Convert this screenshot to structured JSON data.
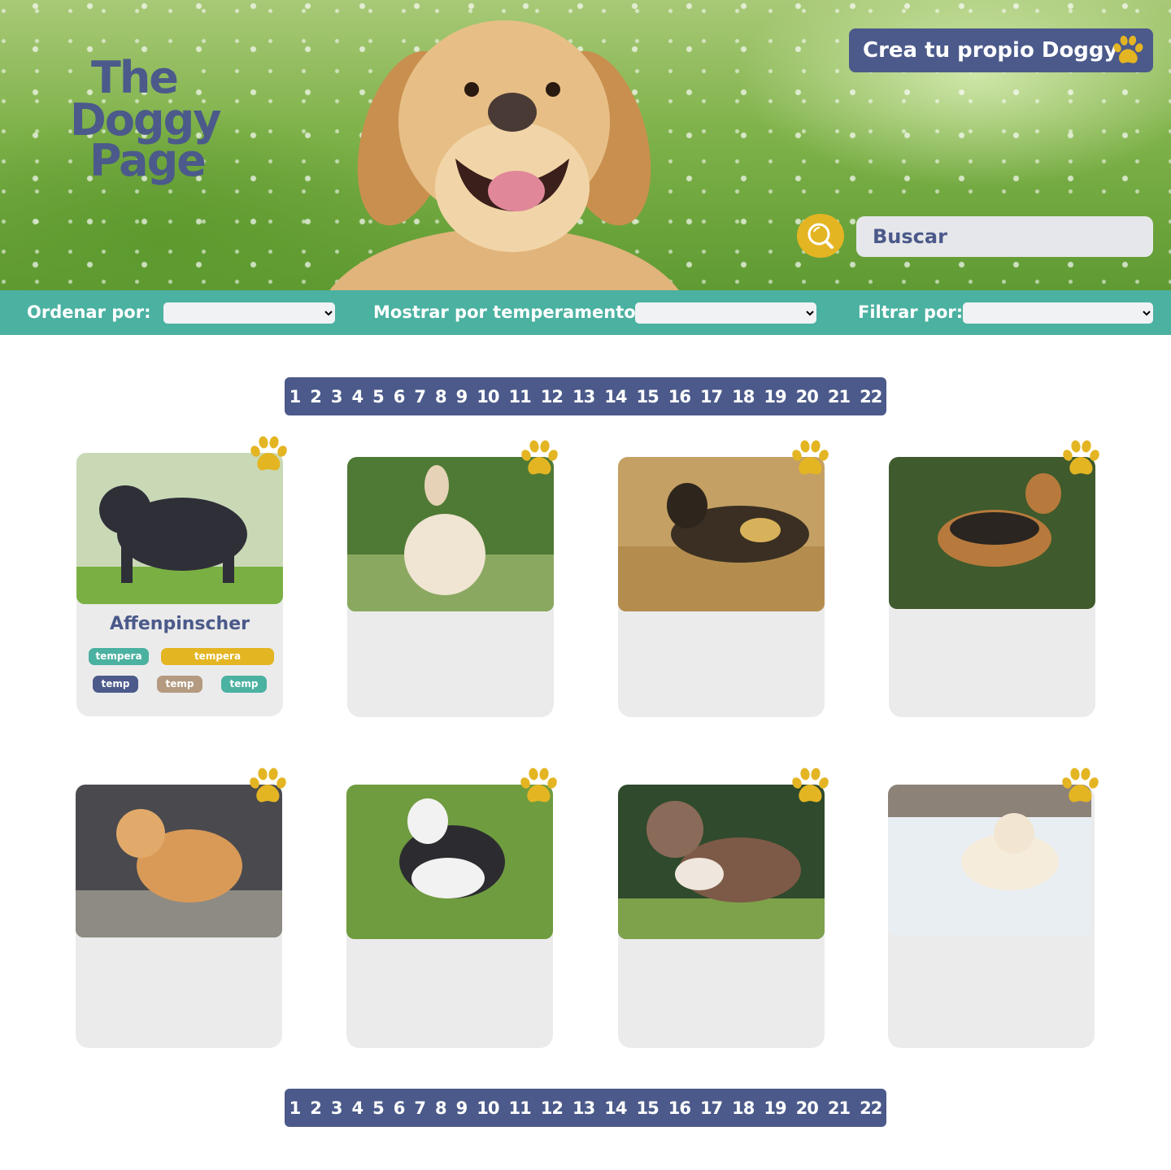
{
  "header": {
    "logo": {
      "line1": "The",
      "line2": "Doggy",
      "line3": "Page"
    },
    "create_button": "Crea tu propio Doggy",
    "search": {
      "placeholder": "Buscar"
    }
  },
  "filters": {
    "sort_label": "Ordenar por:",
    "temperament_label": "Mostrar por temperamento:",
    "filter_label": "Filtrar por:"
  },
  "pagination": [
    "1",
    "2",
    "3",
    "4",
    "5",
    "6",
    "7",
    "8",
    "9",
    "10",
    "11",
    "12",
    "13",
    "14",
    "15",
    "16",
    "17",
    "18",
    "19",
    "20",
    "21",
    "22"
  ],
  "cards": [
    {
      "name": "Affenpinscher",
      "tags": [
        "tempera",
        "tempera",
        "temp",
        "temp",
        "temp"
      ]
    },
    {
      "name": ""
    },
    {
      "name": ""
    },
    {
      "name": ""
    },
    {
      "name": ""
    },
    {
      "name": ""
    },
    {
      "name": ""
    },
    {
      "name": ""
    }
  ],
  "colors": {
    "navy": "#4b5a8a",
    "teal": "#4bb1a1",
    "gold": "#e4b523",
    "tan": "#b39a80",
    "card_bg": "#ebebeb"
  },
  "icons": {
    "paw": "paw-icon",
    "search": "search-icon"
  }
}
